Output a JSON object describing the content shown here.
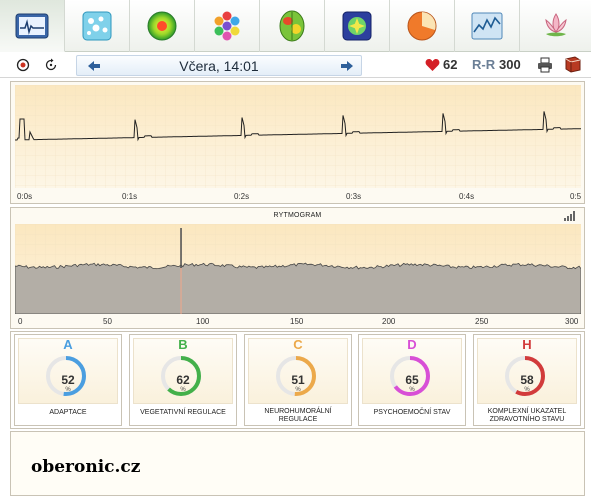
{
  "tabs": [
    {
      "name": "ecg-tab",
      "icon": "ecg-monitor-icon",
      "active": true
    },
    {
      "name": "cells-tab",
      "icon": "cells-icon"
    },
    {
      "name": "energy-tab",
      "icon": "energy-circle-icon"
    },
    {
      "name": "hexagons-tab",
      "icon": "hexagon-chart-icon"
    },
    {
      "name": "brain-tab",
      "icon": "brain-map-icon"
    },
    {
      "name": "chakra-tab",
      "icon": "chakra-icon"
    },
    {
      "name": "pie-tab",
      "icon": "pie-chart-icon"
    },
    {
      "name": "trend-tab",
      "icon": "trend-chart-icon"
    },
    {
      "name": "lotus-tab",
      "icon": "lotus-icon"
    }
  ],
  "toolbar": {
    "date": "Včera, 14:01",
    "heart_rate": "62",
    "rr_label": "R-R",
    "rr_value": "300"
  },
  "ecg": {
    "ticks": [
      "0:0s",
      "0:1s",
      "0:2s",
      "0:3s",
      "0:4s",
      "0:5"
    ]
  },
  "rhythmogram": {
    "title": "RYTMOGRAM",
    "ticks": [
      "0",
      "50",
      "100",
      "150",
      "200",
      "250",
      "300"
    ],
    "marker_index": 88
  },
  "indices": [
    {
      "letter": "A",
      "value": "52",
      "percent": 52,
      "unit": "%",
      "label": "ADAPTACE",
      "color": "#4a9ee0"
    },
    {
      "letter": "B",
      "value": "62",
      "percent": 62,
      "unit": "%",
      "label": "VEGETATIVNÍ REGULACE",
      "color": "#43b04a"
    },
    {
      "letter": "C",
      "value": "51",
      "percent": 51,
      "unit": "%",
      "label": "NEUROHUMORÁLNÍ REGULACE",
      "color": "#eca94a"
    },
    {
      "letter": "D",
      "value": "65",
      "percent": 65,
      "unit": "%",
      "label": "PSYCHOEMOČNÍ STAV",
      "color": "#d84fd6"
    },
    {
      "letter": "H",
      "value": "58",
      "percent": 58,
      "unit": "%",
      "label": "KOMPLEXNÍ UKAZATEL ZDRAVOTNÍHO STAVU",
      "color": "#d23b3b"
    }
  ],
  "watermark": "oberonic.cz"
}
